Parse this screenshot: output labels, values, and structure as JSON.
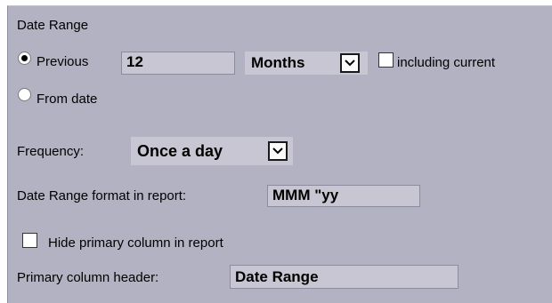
{
  "date_range": {
    "heading": "Date Range",
    "previous_label": "Previous",
    "previous_value": "12",
    "unit_selected": "Months",
    "include_current_label": "including current",
    "from_date_label": "From date",
    "selected_option": "previous"
  },
  "frequency": {
    "label": "Frequency:",
    "selected": "Once a day"
  },
  "date_range_format": {
    "label": "Date Range format in report:",
    "value": "MMM \"yy"
  },
  "hide_primary": {
    "label": "Hide primary column in report",
    "checked": false
  },
  "primary_header": {
    "label": "Primary column header:",
    "value": "Date Range"
  },
  "icons": {
    "dropdown": "chevron-down-icon"
  }
}
